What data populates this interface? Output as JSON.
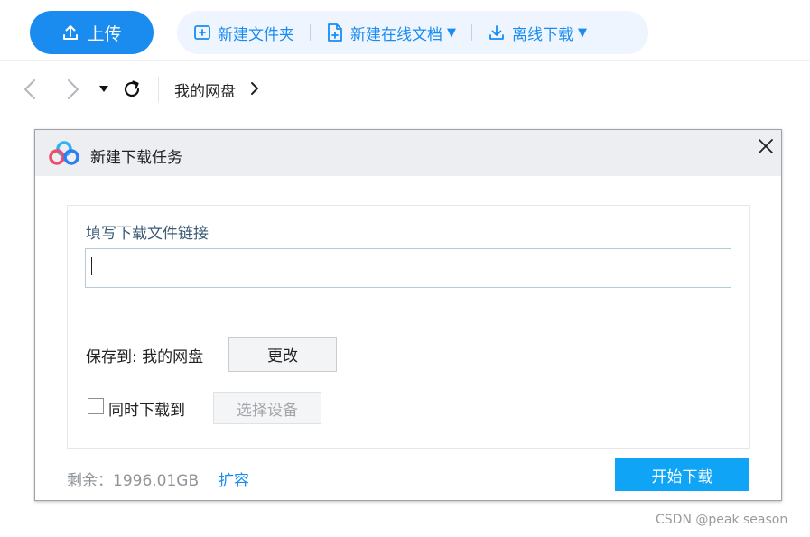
{
  "toolbar": {
    "upload_label": "上传",
    "new_folder_label": "新建文件夹",
    "new_online_doc_label": "新建在线文档",
    "offline_download_label": "离线下载",
    "accent_color": "#1a8cf0",
    "icons": {
      "upload": "upload-icon",
      "new_folder": "folder-plus-icon",
      "new_doc": "doc-plus-icon",
      "offline_download": "download-icon"
    }
  },
  "nav": {
    "breadcrumb_root": "我的网盘",
    "icons": {
      "back": "chevron-left-icon",
      "forward": "chevron-right-icon",
      "history": "caret-down-icon",
      "refresh": "refresh-icon",
      "crumb_arrow": "chevron-right-icon"
    }
  },
  "dialog": {
    "title": "新建下载任务",
    "link_label": "填写下载文件链接",
    "link_value": "",
    "save_to_label": "保存到: 我的网盘",
    "change_label": "更改",
    "sync_download_label": "同时下载到",
    "sync_download_checked": false,
    "select_device_label": "选择设备",
    "remaining_label": "剩余：1996.01GB",
    "expand_label": "扩容",
    "start_label": "开始下载",
    "start_color": "#0fa4f5",
    "icons": {
      "logo": "baidu-netdisk-logo-icon",
      "close": "close-icon"
    }
  },
  "watermark": "CSDN @peak season"
}
